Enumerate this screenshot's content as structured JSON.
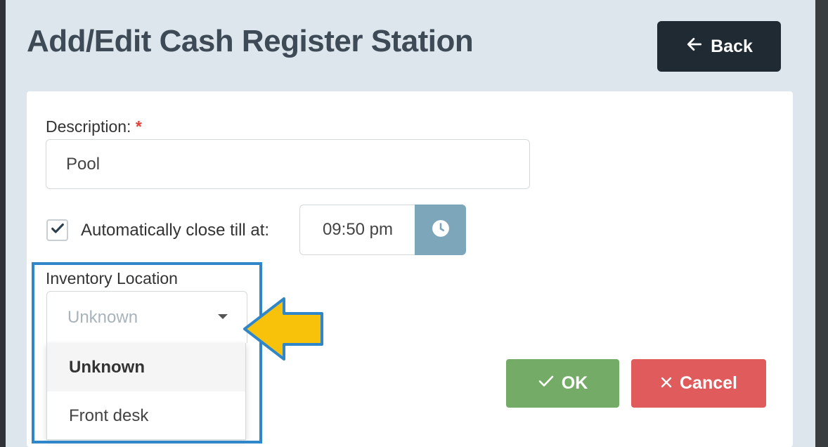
{
  "header": {
    "title": "Add/Edit Cash Register Station",
    "back_label": "Back"
  },
  "form": {
    "description_label": "Description:",
    "required_marker": "*",
    "description_value": "Pool",
    "auto_close_checked": true,
    "auto_close_label": "Automatically close till at:",
    "close_time": "09:50 pm",
    "inventory_label": "Inventory Location",
    "inventory_selected": "Unknown",
    "inventory_options": [
      "Unknown",
      "Front desk"
    ]
  },
  "actions": {
    "ok_label": "OK",
    "cancel_label": "Cancel"
  },
  "colors": {
    "back_button": "#1f2a33",
    "ok_button": "#74ac67",
    "cancel_button": "#e05b5b",
    "clock_button": "#7ea6bb",
    "highlight_box": "#2f86c8",
    "callout_arrow": "#f9c20a"
  },
  "icons": [
    "arrow-left-icon",
    "check-icon",
    "clock-icon",
    "caret-down-icon",
    "checkmark-icon",
    "close-x-icon",
    "callout-arrow-icon"
  ]
}
